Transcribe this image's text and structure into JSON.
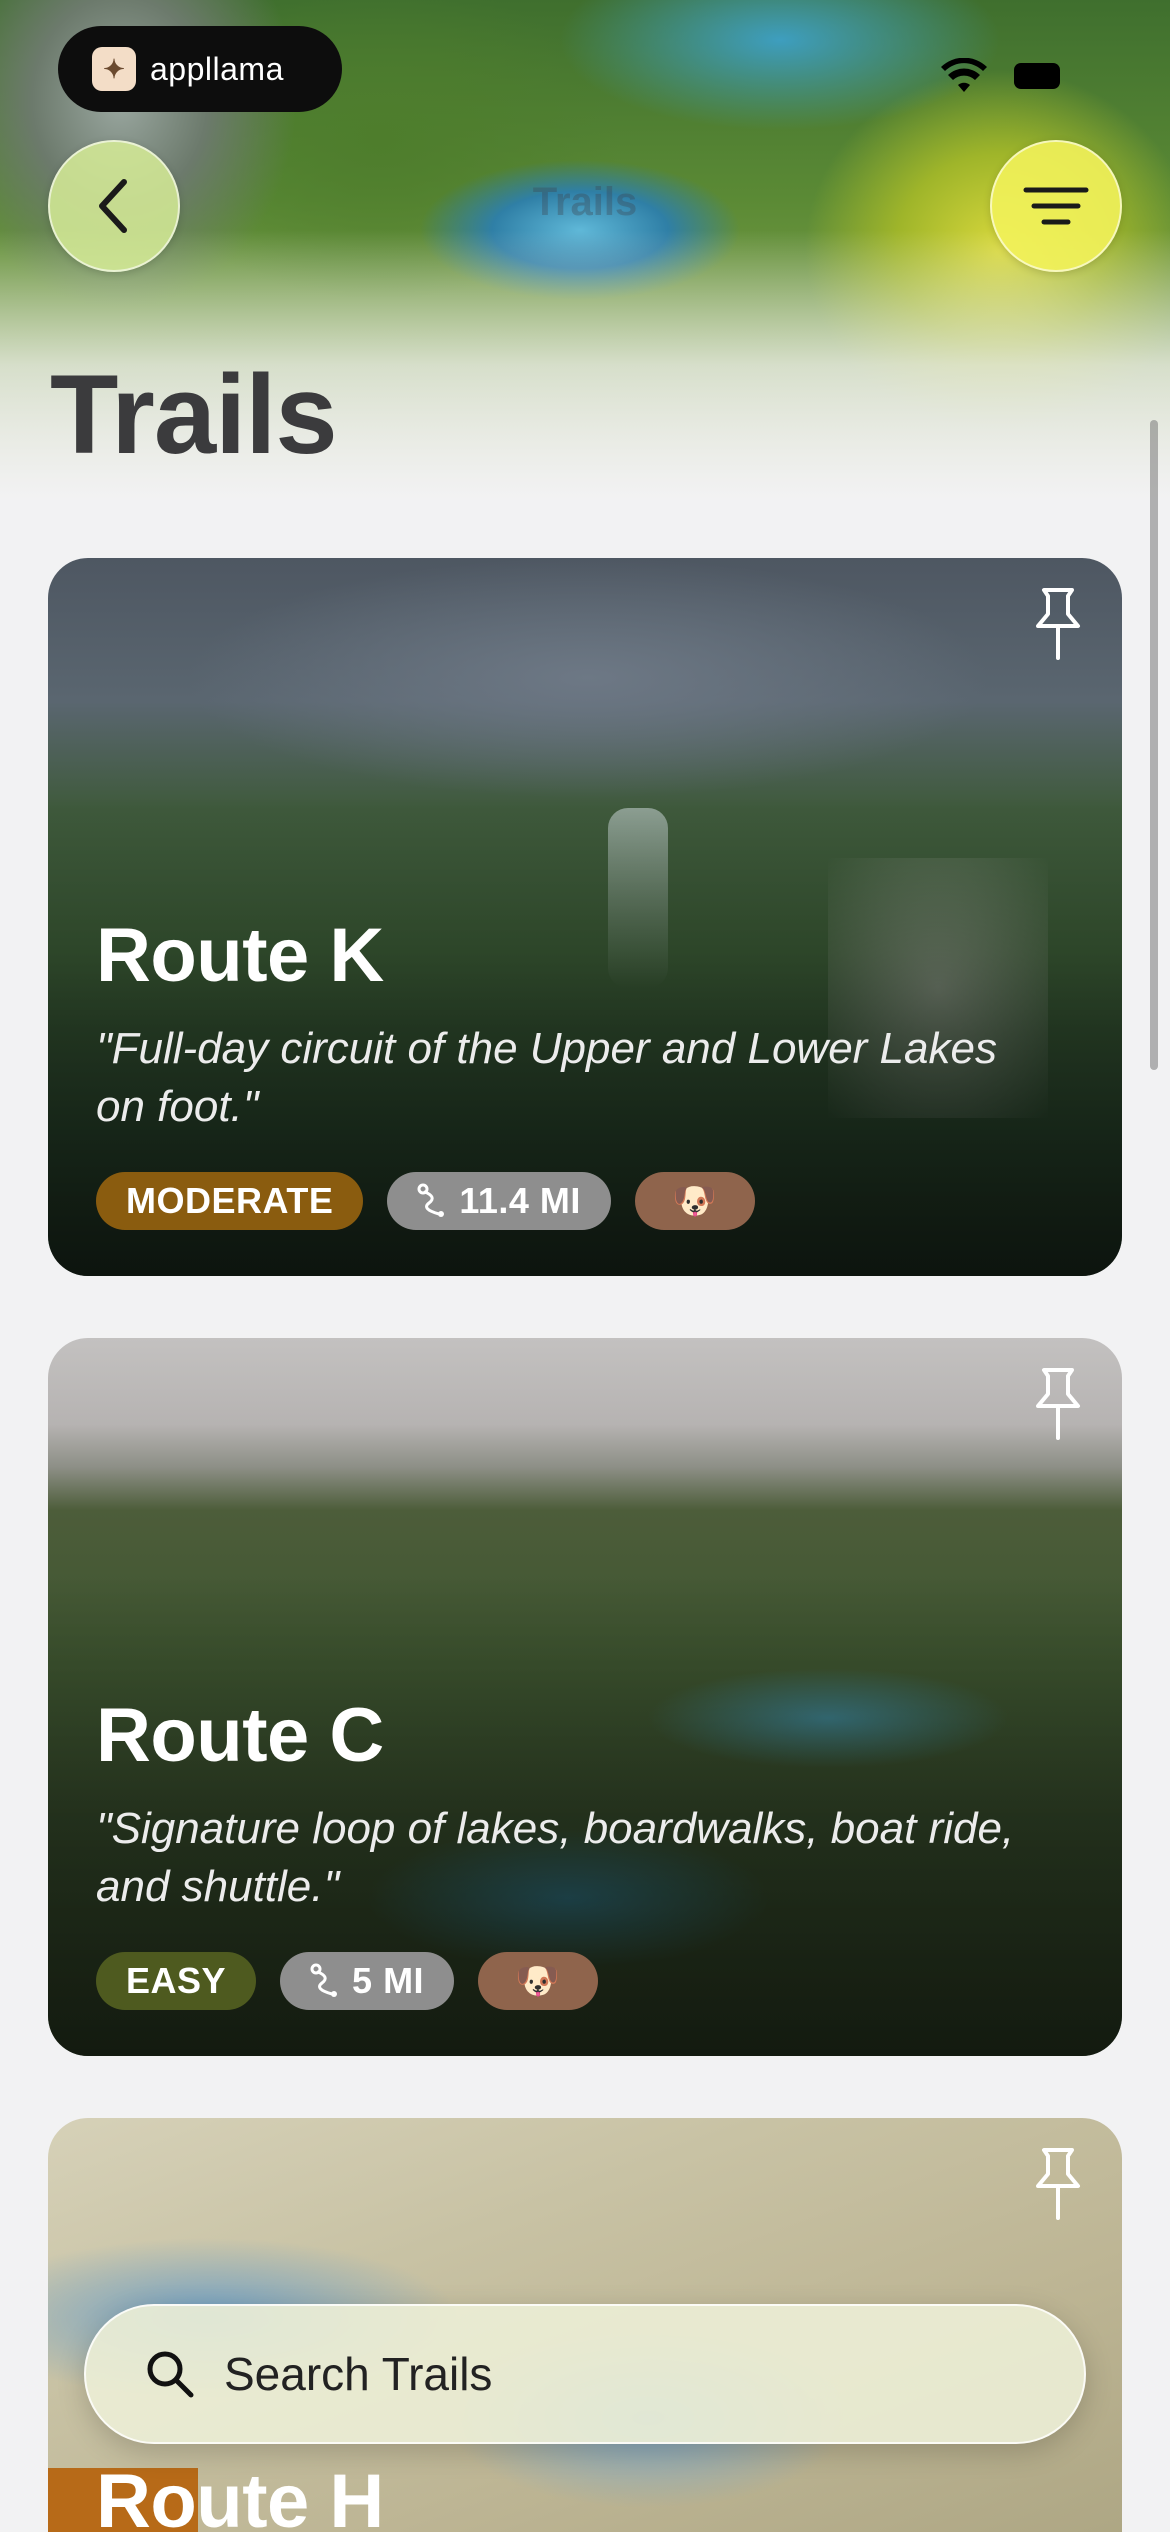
{
  "brand": {
    "name": "appllama"
  },
  "nav": {
    "title": "Trails"
  },
  "page": {
    "title": "Trails"
  },
  "trails": [
    {
      "name": "Route K",
      "description": "\"Full-day circuit of the Upper and Lower Lakes on foot.\"",
      "difficulty": "MODERATE",
      "distance": "11.4 MI",
      "dog_icon": "🐶"
    },
    {
      "name": "Route C",
      "description": "\"Signature loop of lakes, boardwalks, boat ride, and shuttle.\"",
      "difficulty": "EASY",
      "distance": "5 MI",
      "dog_icon": "🐶"
    },
    {
      "name": "Route H"
    }
  ],
  "search": {
    "placeholder": "Search Trails"
  },
  "icons": {
    "back": "chevron-left-icon",
    "menu": "menu-icon",
    "pin": "pin-icon",
    "search": "search-icon",
    "route": "route-icon",
    "dog": "dog-icon"
  },
  "colors": {
    "moderate": "#8a5c0f",
    "easy": "#4e5a1f",
    "distance": "#8e8e8e",
    "dog": "#8f644c",
    "menu_button": "#f2f25a",
    "back_button": "#d6ec96"
  }
}
